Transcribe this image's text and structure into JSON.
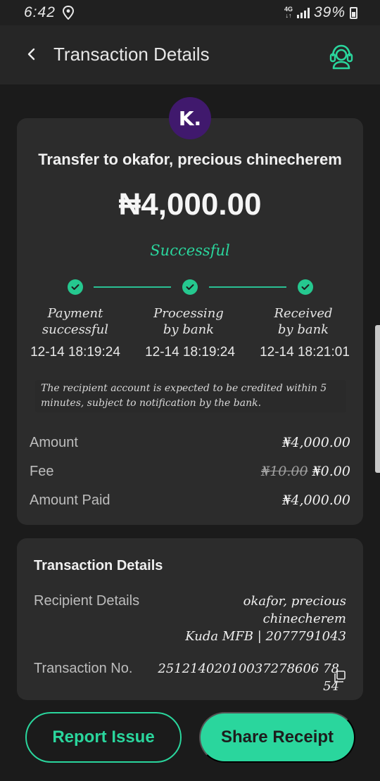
{
  "status_bar": {
    "time": "6:42",
    "network": "4G",
    "battery": "39%"
  },
  "header": {
    "back_label": "‹",
    "title": "Transaction Details"
  },
  "summary": {
    "merchant_logo_text": "K.",
    "title": "Transfer to okafor, precious chinecherem",
    "amount": "₦4,000.00",
    "status": "Successful"
  },
  "progress": {
    "steps": [
      {
        "label_line1": "Payment",
        "label_line2": "successful",
        "time": "12-14 18:19:24"
      },
      {
        "label_line1": "Processing",
        "label_line2": "by bank",
        "time": "12-14 18:19:24"
      },
      {
        "label_line1": "Received",
        "label_line2": "by bank",
        "time": "12-14 18:21:01"
      }
    ]
  },
  "note": "The recipient account is expected to be credited within 5 minutes, subject to notification by the bank.",
  "amounts": {
    "amount_label": "Amount",
    "amount_value": "₦4,000.00",
    "fee_label": "Fee",
    "fee_original": "₦10.00",
    "fee_value": "₦0.00",
    "paid_label": "Amount Paid",
    "paid_value": "₦4,000.00"
  },
  "details": {
    "title": "Transaction Details",
    "recipient_label": "Recipient Details",
    "recipient_name_line1": "okafor, precious",
    "recipient_name_line2": "chinecherem",
    "recipient_bank": "Kuda MFB | 2077791043",
    "txn_label": "Transaction No.",
    "txn_line1": "25121402010037278606 78",
    "txn_line2": "54"
  },
  "actions": {
    "report_label": "Report Issue",
    "share_label": "Share Receipt"
  },
  "colors": {
    "accent": "#2ad69d",
    "background": "#1b1b1b",
    "card": "#2c2c2c",
    "logo": "#40196d"
  },
  "icons": {
    "back": "chevron-left-icon",
    "support": "headset-agent-icon",
    "copy": "copy-icon",
    "check": "check-icon"
  }
}
